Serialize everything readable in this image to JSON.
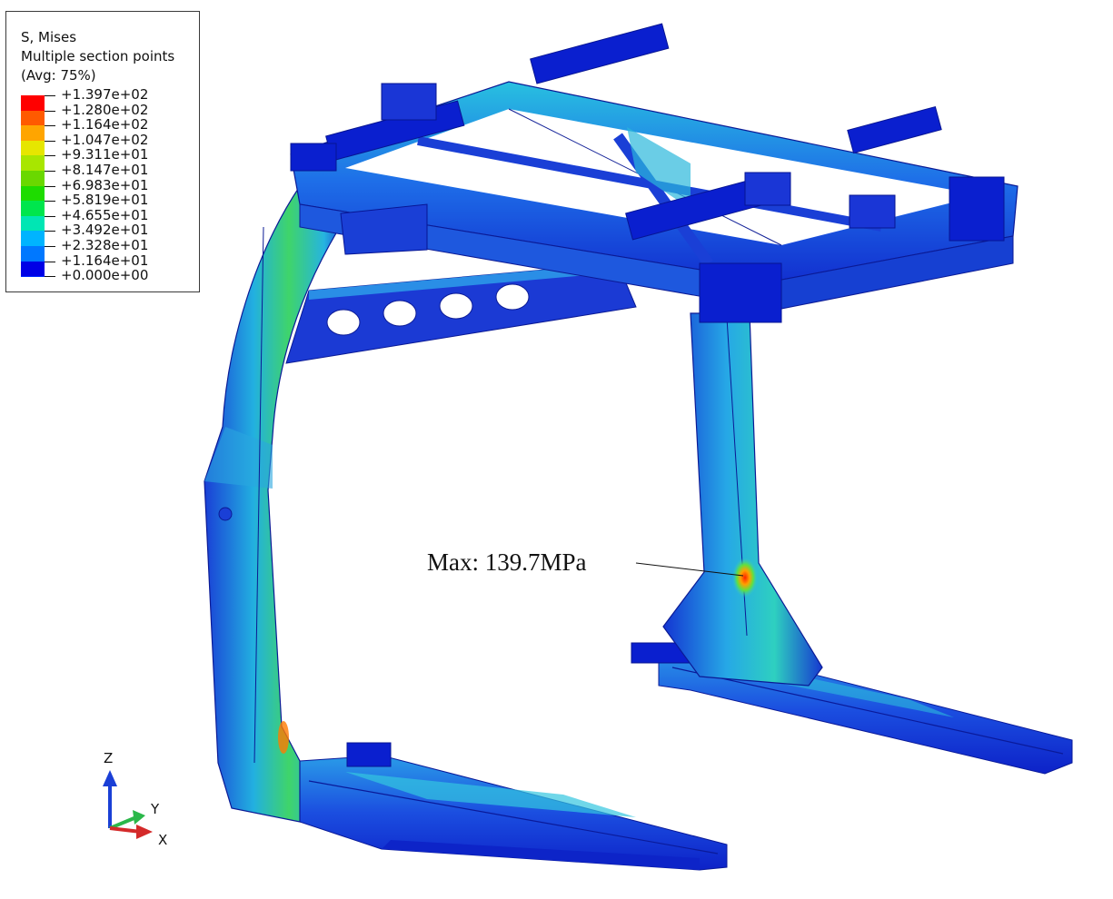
{
  "legend": {
    "title_lines": [
      "S, Mises",
      "Multiple section points",
      "(Avg: 75%)"
    ],
    "levels": [
      {
        "label": "+1.397e+02",
        "color": "#ff0000"
      },
      {
        "label": "+1.280e+02",
        "color": "#ff5a00"
      },
      {
        "label": "+1.164e+02",
        "color": "#ffa500"
      },
      {
        "label": "+1.047e+02",
        "color": "#e6e600"
      },
      {
        "label": "+9.311e+01",
        "color": "#a8e600"
      },
      {
        "label": "+8.147e+01",
        "color": "#6ad800"
      },
      {
        "label": "+6.983e+01",
        "color": "#1edc00"
      },
      {
        "label": "+5.819e+01",
        "color": "#00e64d"
      },
      {
        "label": "+4.655e+01",
        "color": "#00e6b4"
      },
      {
        "label": "+3.492e+01",
        "color": "#00b4ff"
      },
      {
        "label": "+2.328e+01",
        "color": "#0078ff"
      },
      {
        "label": "+1.164e+01",
        "color": "#0028ff"
      },
      {
        "label": "+0.000e+00",
        "color": "#0000e6"
      }
    ]
  },
  "annotation": {
    "max_label": "Max: 139.7MPa"
  },
  "triad": {
    "z": "Z",
    "y": "Y",
    "x": "X"
  },
  "colors": {
    "max_spot": "#ff2a00",
    "base_blue": "#1a3fd6",
    "deep_blue": "#0a1fcf",
    "cyan": "#25c8d8",
    "green": "#3fd44a"
  }
}
